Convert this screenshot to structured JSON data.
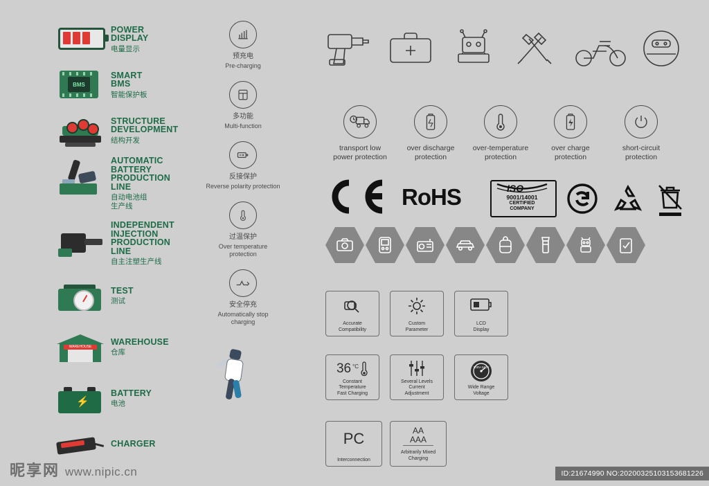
{
  "page": {
    "background": "#cfcfcf",
    "brand_green": "#1d6b47",
    "accent_red": "#e03a35",
    "gray_hex": "#878787"
  },
  "process_column": {
    "items": [
      {
        "en": "POWER\nDISPLAY",
        "en_lines": [
          "POWER",
          "DISPLAY"
        ],
        "cn": "电量显示",
        "icon": "battery-level-icon"
      },
      {
        "en_lines": [
          "SMART",
          "BMS"
        ],
        "cn": "智能保护板",
        "icon": "bms-chip-icon",
        "chip_label": "BMS"
      },
      {
        "en_lines": [
          "STRUCTURE",
          "DEVELOPMENT"
        ],
        "cn": "结构开发",
        "icon": "structure-dev-icon"
      },
      {
        "en_lines": [
          "AUTOMATIC",
          "BATTERY",
          "PRODUCTION",
          "LINE"
        ],
        "cn": "自动电池组\n生产线",
        "cn_lines": [
          "自动电池组",
          "生产线"
        ],
        "icon": "robot-arm-icon"
      },
      {
        "en_lines": [
          "INDEPENDENT",
          "INJECTION",
          "PRODUCTION",
          "LINE"
        ],
        "cn": "自主注塑生产线",
        "icon": "injection-machine-icon"
      },
      {
        "en_lines": [
          "TEST"
        ],
        "cn": "测试",
        "icon": "test-gauge-icon"
      },
      {
        "en_lines": [
          "WAREHOUSE"
        ],
        "cn": "仓库",
        "icon": "warehouse-icon",
        "sign_text": "WAREHOUSE"
      },
      {
        "en_lines": [
          "BATTERY"
        ],
        "cn": "电池",
        "icon": "battery-pack-icon"
      },
      {
        "en_lines": [
          "CHARGER"
        ],
        "cn": "",
        "icon": "charger-icon"
      }
    ]
  },
  "feature_circles": {
    "items": [
      {
        "icon": "pre-charging-icon",
        "cn": "预充电",
        "en": "Pre-charging"
      },
      {
        "icon": "multi-function-icon",
        "cn": "多功能",
        "en": "Multi-function"
      },
      {
        "icon": "reverse-polarity-icon",
        "cn": "反接保护",
        "en": "Reverse polarity protection"
      },
      {
        "icon": "over-temperature-icon",
        "cn": "过温保护",
        "en": "Over temperature protection"
      },
      {
        "icon": "auto-stop-charging-icon",
        "cn": "安全停充",
        "en": "Automatically stop charging"
      }
    ]
  },
  "applications": {
    "items": [
      {
        "icon": "power-drill-icon",
        "label": ""
      },
      {
        "icon": "first-aid-kit-icon",
        "label": ""
      },
      {
        "icon": "toy-robot-icon",
        "label": ""
      },
      {
        "icon": "garden-tools-icon",
        "label": ""
      },
      {
        "icon": "electric-scooter-icon",
        "label": ""
      },
      {
        "icon": "robot-vacuum-icon",
        "label": ""
      }
    ]
  },
  "protections": {
    "items": [
      {
        "icon": "transport-truck-icon",
        "lines": [
          "transport low",
          "power protection"
        ]
      },
      {
        "icon": "over-discharge-icon",
        "lines": [
          "over discharge",
          "protection"
        ]
      },
      {
        "icon": "thermometer-icon",
        "lines": [
          "over-temperature",
          "protection"
        ]
      },
      {
        "icon": "over-charge-icon",
        "lines": [
          "over charge",
          "protection"
        ]
      },
      {
        "icon": "short-circuit-icon",
        "lines": [
          "short-circuit",
          "protection"
        ]
      }
    ]
  },
  "certifications": {
    "ce": "CE",
    "rohs": "RoHS",
    "iso": {
      "name": "ISO",
      "standard": "9001/14001",
      "line2": "CERTIFIED",
      "line3": "COMPANY"
    },
    "icons": [
      "recycle-arrow-icon",
      "recycle-triangle-icon",
      "weee-bin-icon"
    ]
  },
  "device_hexes": {
    "items": [
      {
        "icon": "camera-icon"
      },
      {
        "icon": "handheld-game-icon"
      },
      {
        "icon": "radio-icon"
      },
      {
        "icon": "car-icon"
      },
      {
        "icon": "backpack-icon"
      },
      {
        "icon": "flashlight-icon"
      },
      {
        "icon": "toy-robot-hex-icon"
      },
      {
        "icon": "clipboard-icon"
      }
    ]
  },
  "charger_features": {
    "items": [
      {
        "icon": "magnifier-battery-icon",
        "lines": [
          "Accurate",
          "Compatibility"
        ]
      },
      {
        "icon": "gear-icon",
        "lines": [
          "Custom",
          "Parameter"
        ]
      },
      {
        "icon": "lcd-display-icon",
        "lines": [
          "LCD",
          "Display"
        ]
      },
      {
        "icon": "thermometer-36c-icon",
        "value": "36",
        "unit": "°C",
        "lines": [
          "Constant",
          "Temperature",
          "Fast Charging"
        ]
      },
      {
        "icon": "sliders-icon",
        "lines": [
          "Several Levels",
          "Current",
          "Adjustment"
        ]
      },
      {
        "icon": "voltage-dial-icon",
        "value": "100V-240V",
        "lines": [
          "Wide Range",
          "Voltage"
        ]
      },
      {
        "icon": "pc-interconnection-icon",
        "value": "PC",
        "lines": [
          "Interconnection"
        ]
      },
      {
        "icon": "aa-aaa-icon",
        "value_top": "AA",
        "value_bottom": "AAA",
        "lines": [
          "Arbitrarily Mixed",
          "Charging"
        ]
      }
    ]
  },
  "watermark": {
    "cn": "昵享网",
    "url": "www.nipic.cn",
    "id_text": "ID:21674990  NO:20200325103153681226"
  }
}
